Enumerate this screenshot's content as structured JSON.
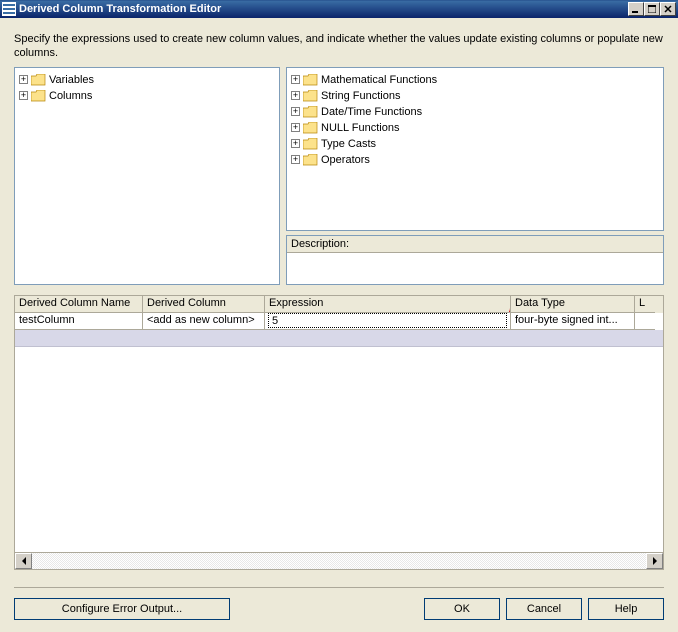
{
  "window": {
    "title": "Derived Column Transformation Editor"
  },
  "instruction": "Specify the expressions used to create new column values, and indicate whether the values update existing columns or populate new columns.",
  "left_tree": {
    "items": [
      {
        "label": "Variables"
      },
      {
        "label": "Columns"
      }
    ]
  },
  "right_tree": {
    "items": [
      {
        "label": "Mathematical Functions"
      },
      {
        "label": "String Functions"
      },
      {
        "label": "Date/Time Functions"
      },
      {
        "label": "NULL Functions"
      },
      {
        "label": "Type Casts"
      },
      {
        "label": "Operators"
      }
    ]
  },
  "description_label": "Description:",
  "grid": {
    "headers": {
      "c1": "Derived Column Name",
      "c2": "Derived Column",
      "c3": "Expression",
      "c4": "Data Type",
      "c5": "L"
    },
    "row": {
      "name": "testColumn",
      "derived": "<add as new column>",
      "expression": "5",
      "datatype": "four-byte signed int..."
    }
  },
  "buttons": {
    "config": "Configure Error Output...",
    "ok": "OK",
    "cancel": "Cancel",
    "help": "Help"
  }
}
